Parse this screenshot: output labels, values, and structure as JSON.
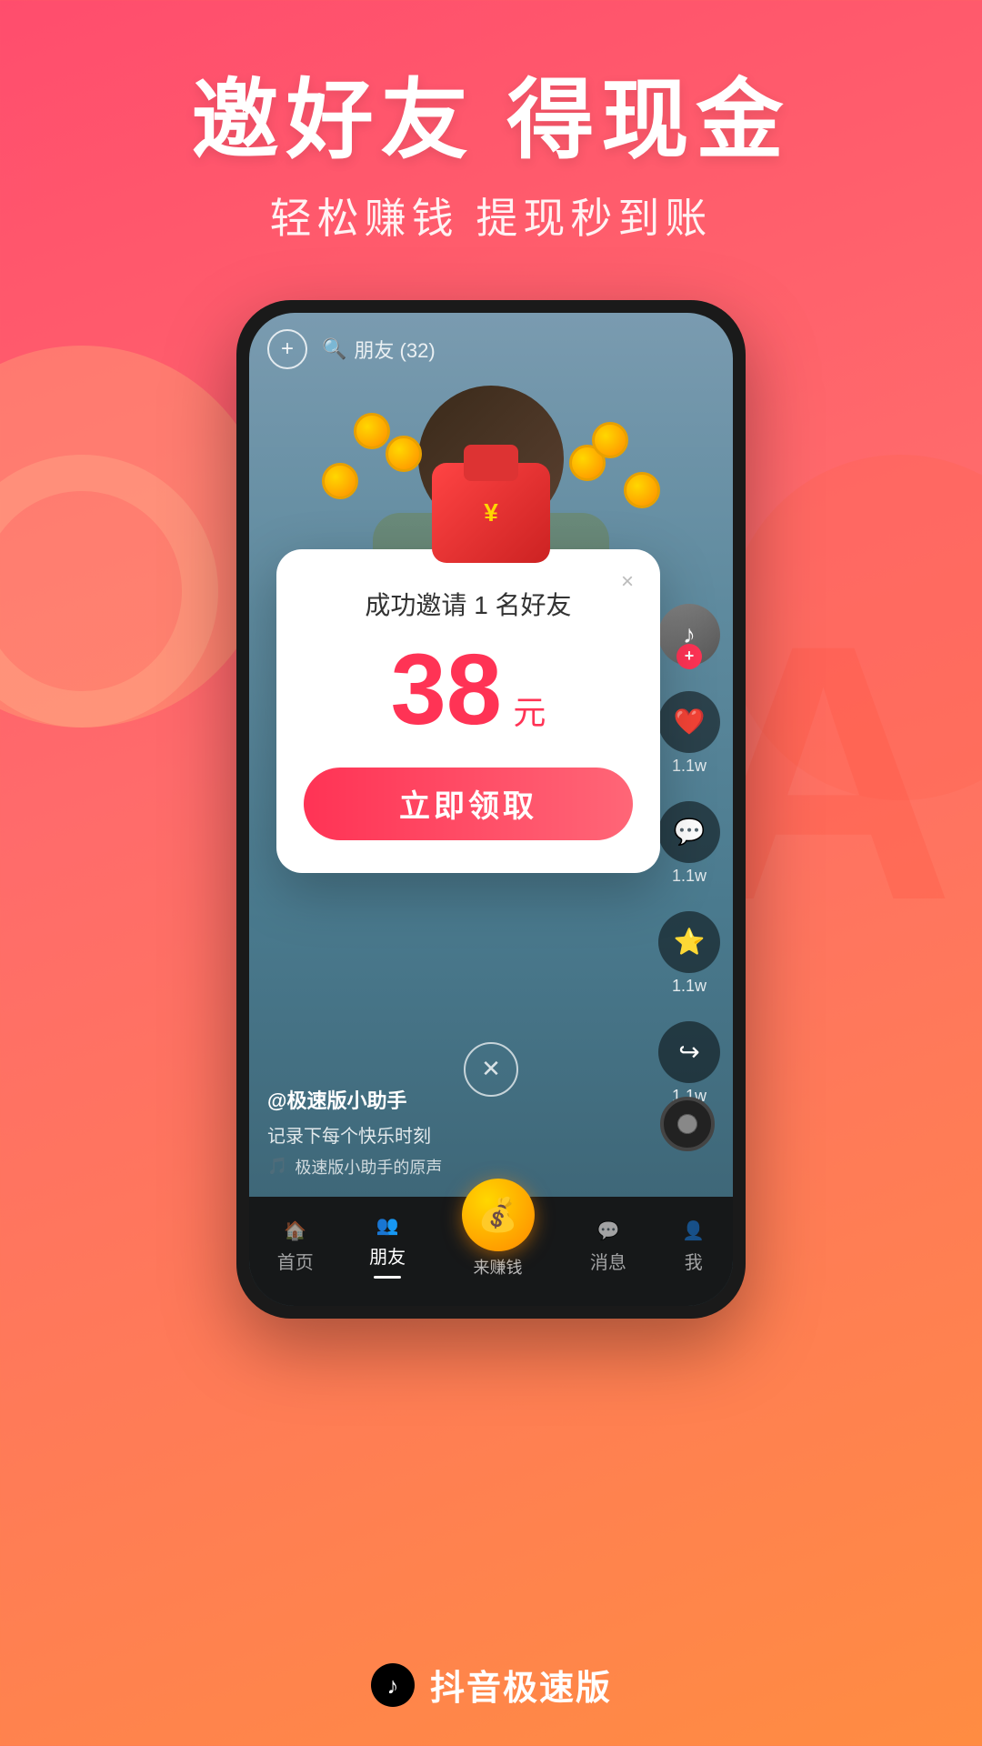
{
  "header": {
    "main_title": "邀好友 得现金",
    "sub_title": "轻松赚钱 提现秒到账"
  },
  "phone": {
    "topbar": {
      "add_btn": "+",
      "search_icon": "🔍",
      "search_label": "朋友 (32)"
    },
    "popup": {
      "title": "成功邀请 1 名好友",
      "amount": "38",
      "unit": "元",
      "claim_btn": "立即领取",
      "close_icon": "×"
    },
    "video": {
      "username": "@极速版小助手",
      "description": "记录下每个快乐时刻",
      "music": "🎵 极速版小助手的原声"
    },
    "sidebar": {
      "profile_count": "",
      "like_count": "1.1w",
      "comment_count": "1.1w",
      "star_count": "1.1w",
      "share_count": "1.1w"
    },
    "navbar": {
      "home": "首页",
      "friends": "朋友",
      "earn": "来赚钱",
      "messages": "消息",
      "profile": "我"
    }
  },
  "branding": {
    "app_name": "抖音极速版"
  }
}
